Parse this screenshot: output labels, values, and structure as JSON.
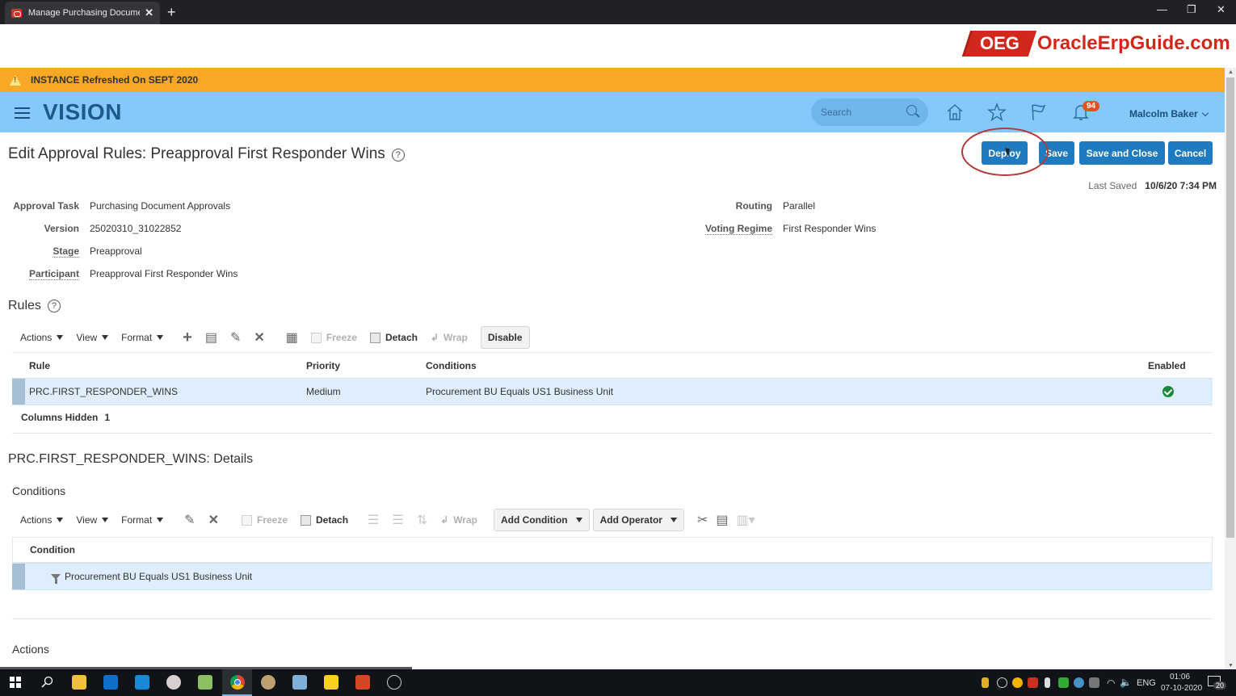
{
  "browser": {
    "tab_title": "Manage Purchasing Document A",
    "tab_close": "✕",
    "new_tab": "+",
    "minimize": "—",
    "restore": "❐",
    "close": "✕"
  },
  "logo": {
    "badge": "OEG",
    "text": "OracleErpGuide.com"
  },
  "banner": {
    "icon": "warning-icon",
    "text": "INSTANCE Refreshed On SEPT 2020",
    "color": "#f9a825"
  },
  "header": {
    "brand": "VISION",
    "search_placeholder": "Search",
    "notification_count": "94",
    "user_name": "Malcolm Baker",
    "color": "#84c8fc"
  },
  "page": {
    "title": "Edit Approval Rules: Preapproval First Responder Wins",
    "help": "?",
    "buttons": {
      "deploy": "Deploy",
      "save": "Save",
      "save_and_close": "Save and Close",
      "cancel": "Cancel"
    },
    "last_saved_label": "Last Saved",
    "last_saved_value": "10/6/20 7:34 PM"
  },
  "info": {
    "left": [
      {
        "label": "Approval Task",
        "value": "Purchasing Document Approvals"
      },
      {
        "label": "Version",
        "value": "25020310_31022852"
      },
      {
        "label": "Stage",
        "value": "Preapproval"
      },
      {
        "label": "Participant",
        "value": "Preapproval First Responder Wins"
      }
    ],
    "right": [
      {
        "label": "Routing",
        "value": "Parallel"
      },
      {
        "label": "Voting Regime",
        "value": "First Responder Wins"
      }
    ]
  },
  "rules": {
    "title": "Rules",
    "toolbar": {
      "actions": "Actions",
      "view": "View",
      "format": "Format",
      "freeze": "Freeze",
      "detach": "Detach",
      "wrap": "Wrap",
      "disable": "Disable"
    },
    "columns": [
      "Rule",
      "Priority",
      "Conditions",
      "Enabled"
    ],
    "rows": [
      {
        "rule": "PRC.FIRST_RESPONDER_WINS",
        "priority": "Medium",
        "conditions": "Procurement BU Equals US1 Business Unit",
        "enabled": true
      }
    ],
    "columns_hidden_label": "Columns Hidden",
    "columns_hidden_count": "1"
  },
  "details": {
    "title": "PRC.FIRST_RESPONDER_WINS: Details",
    "conditions_title": "Conditions",
    "toolbar": {
      "actions": "Actions",
      "view": "View",
      "format": "Format",
      "freeze": "Freeze",
      "detach": "Detach",
      "wrap": "Wrap",
      "add_condition": "Add Condition",
      "add_operator": "Add Operator"
    },
    "column": "Condition",
    "rows": [
      {
        "condition": "Procurement BU Equals US1 Business Unit"
      }
    ],
    "actions_title": "Actions"
  },
  "taskbar": {
    "lang": "ENG",
    "time": "01:06",
    "date": "07-10-2020",
    "notifications": "20"
  }
}
